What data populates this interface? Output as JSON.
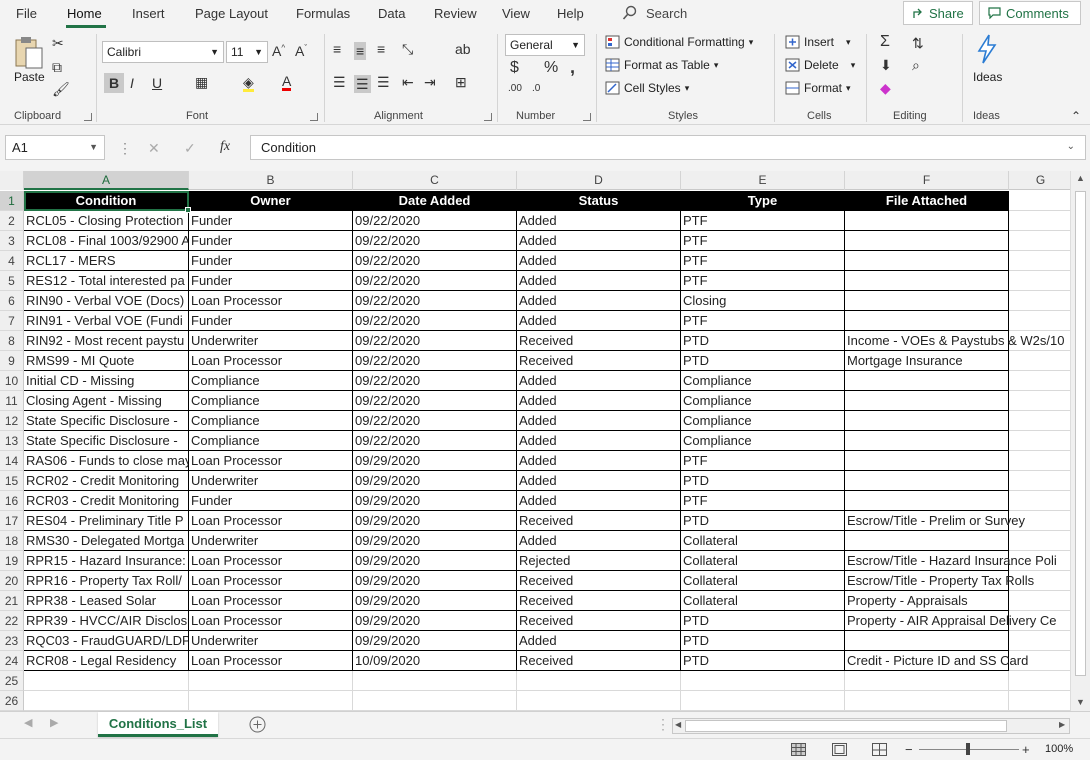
{
  "menu": {
    "tabs": [
      "File",
      "Home",
      "Insert",
      "Page Layout",
      "Formulas",
      "Data",
      "Review",
      "View",
      "Help"
    ],
    "search_label": "Search",
    "share_label": "Share",
    "comments_label": "Comments"
  },
  "ribbon": {
    "clipboard": {
      "paste_label": "Paste",
      "group_label": "Clipboard"
    },
    "font": {
      "font_name": "Calibri",
      "font_size": "11",
      "group_label": "Font"
    },
    "alignment": {
      "group_label": "Alignment"
    },
    "number": {
      "format": "General",
      "group_label": "Number"
    },
    "styles": {
      "conditional_label": "Conditional Formatting",
      "format_table_label": "Format as Table",
      "cell_styles_label": "Cell Styles",
      "group_label": "Styles"
    },
    "cells": {
      "insert_label": "Insert",
      "delete_label": "Delete",
      "format_label": "Format",
      "group_label": "Cells"
    },
    "editing": {
      "group_label": "Editing"
    },
    "ideas": {
      "ideas_label": "Ideas",
      "group_label": "Ideas"
    }
  },
  "formula_bar": {
    "name_box": "A1",
    "fx": "fx",
    "content": "Condition"
  },
  "sheet": {
    "columns": [
      "A",
      "B",
      "C",
      "D",
      "E",
      "F",
      "G"
    ],
    "headers": [
      "Condition",
      "Owner",
      "Date Added",
      "Status",
      "Type",
      "File Attached"
    ],
    "rows": [
      [
        "RCL05 - Closing Protection",
        "Funder",
        "09/22/2020",
        "Added",
        "PTF",
        ""
      ],
      [
        "RCL08 - Final 1003/92900 A",
        "Funder",
        "09/22/2020",
        "Added",
        "PTF",
        ""
      ],
      [
        "RCL17 - MERS",
        "Funder",
        "09/22/2020",
        "Added",
        "PTF",
        ""
      ],
      [
        "RES12 - Total interested pa",
        "Funder",
        "09/22/2020",
        "Added",
        "PTF",
        ""
      ],
      [
        "RIN90 - Verbal VOE (Docs)",
        "Loan Processor",
        "09/22/2020",
        "Added",
        "Closing",
        ""
      ],
      [
        "RIN91 - Verbal VOE (Fundi",
        "Funder",
        "09/22/2020",
        "Added",
        "PTF",
        ""
      ],
      [
        "RIN92 - Most recent paystu",
        "Underwriter",
        "09/22/2020",
        "Received",
        "PTD",
        "Income - VOEs & Paystubs & W2s/10"
      ],
      [
        "RMS99 - MI Quote",
        "Loan Processor",
        "09/22/2020",
        "Received",
        "PTD",
        "Mortgage Insurance"
      ],
      [
        "Initial CD - Missing",
        "Compliance",
        "09/22/2020",
        "Added",
        "Compliance",
        ""
      ],
      [
        "Closing Agent - Missing",
        "Compliance",
        "09/22/2020",
        "Added",
        "Compliance",
        ""
      ],
      [
        "State Specific Disclosure -",
        "Compliance",
        "09/22/2020",
        "Added",
        "Compliance",
        ""
      ],
      [
        "State Specific Disclosure -",
        "Compliance",
        "09/22/2020",
        "Added",
        "Compliance",
        ""
      ],
      [
        "RAS06 - Funds to close may",
        "Loan Processor",
        "09/29/2020",
        "Added",
        "PTF",
        ""
      ],
      [
        "RCR02 - Credit Monitoring",
        "Underwriter",
        "09/29/2020",
        "Added",
        "PTD",
        ""
      ],
      [
        "RCR03 - Credit Monitoring",
        "Funder",
        "09/29/2020",
        "Added",
        "PTF",
        ""
      ],
      [
        "RES04 - Preliminary Title P",
        "Loan Processor",
        "09/29/2020",
        "Received",
        "PTD",
        "Escrow/Title - Prelim or Survey"
      ],
      [
        "RMS30 - Delegated Mortga",
        "Underwriter",
        "09/29/2020",
        "Added",
        "Collateral",
        ""
      ],
      [
        "RPR15 - Hazard Insurance:",
        "Loan Processor",
        "09/29/2020",
        "Rejected",
        "Collateral",
        "Escrow/Title - Hazard Insurance Poli"
      ],
      [
        "RPR16 - Property Tax Roll/",
        "Loan Processor",
        "09/29/2020",
        "Received",
        "Collateral",
        "Escrow/Title - Property Tax Rolls"
      ],
      [
        "RPR38 - Leased Solar",
        "Loan Processor",
        "09/29/2020",
        "Received",
        "Collateral",
        "Property - Appraisals"
      ],
      [
        "RPR39 - HVCC/AIR Disclosu",
        "Loan Processor",
        "09/29/2020",
        "Received",
        "PTD",
        "Property - AIR Appraisal Delivery Ce"
      ],
      [
        "RQC03 - FraudGUARD/LDP,",
        "Underwriter",
        "09/29/2020",
        "Added",
        "PTD",
        ""
      ],
      [
        "RCR08 - Legal Residency",
        "Loan Processor",
        "10/09/2020",
        "Received",
        "PTD",
        "Credit - Picture ID and SS Card"
      ]
    ],
    "row_numbers": [
      "1",
      "2",
      "3",
      "4",
      "5",
      "6",
      "7",
      "8",
      "9",
      "10",
      "11",
      "12",
      "13",
      "14",
      "15",
      "16",
      "17",
      "18",
      "19",
      "20",
      "21",
      "22",
      "23",
      "24",
      "25",
      "26"
    ],
    "tab_name": "Conditions_List"
  },
  "status_bar": {
    "zoom": "100%"
  },
  "colors": {
    "accent": "#217346",
    "header_bg": "#000000"
  }
}
